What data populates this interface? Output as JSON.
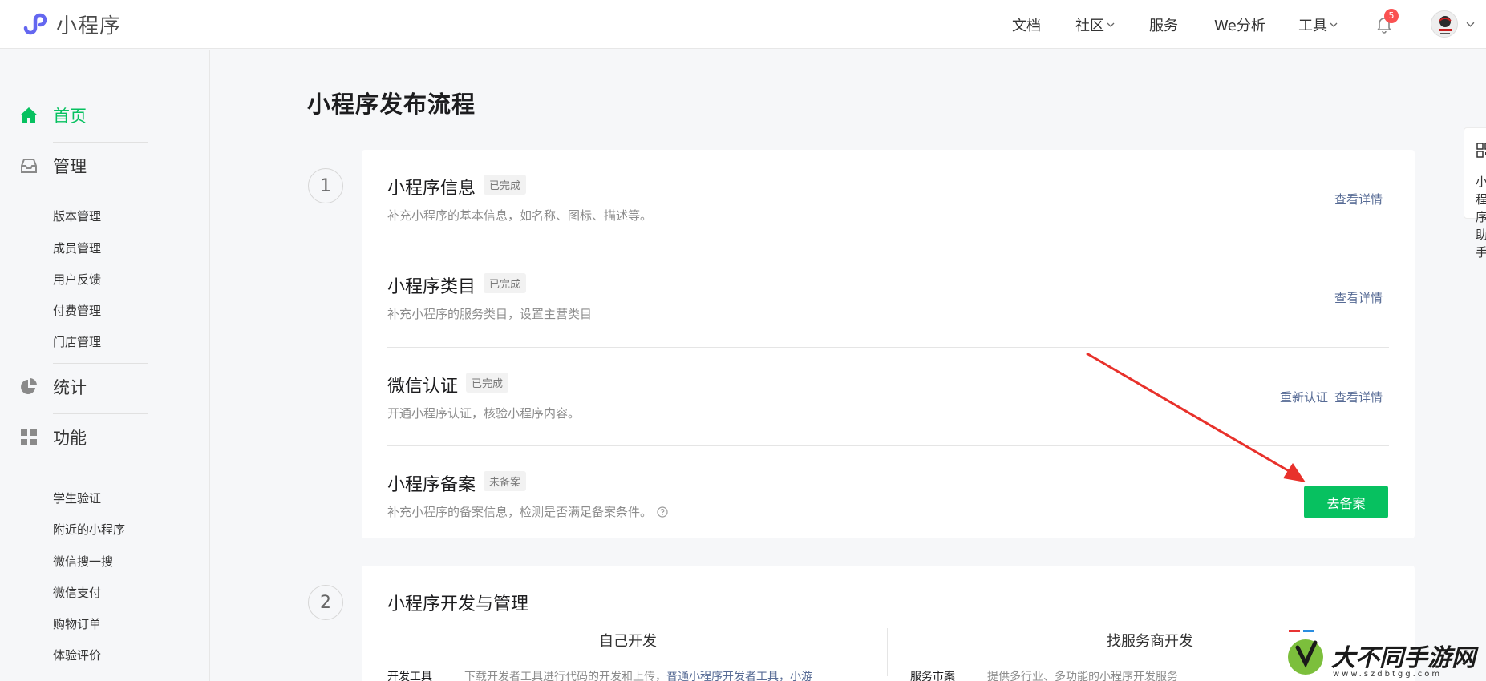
{
  "header": {
    "logo_text": "小程序",
    "nav": [
      {
        "label": "文档",
        "has_dropdown": false
      },
      {
        "label": "社区",
        "has_dropdown": true
      },
      {
        "label": "服务",
        "has_dropdown": false
      },
      {
        "label": "We分析",
        "has_dropdown": false
      },
      {
        "label": "工具",
        "has_dropdown": true
      }
    ],
    "notification_count": "5",
    "icons": [
      "logo-icon",
      "bell-icon",
      "avatar",
      "chevron-down-icon"
    ]
  },
  "sidebar": {
    "home": {
      "label": "首页",
      "icon": "home-icon",
      "active": true
    },
    "manage": {
      "label": "管理",
      "icon": "inbox-icon",
      "items": [
        "版本管理",
        "成员管理",
        "用户反馈",
        "付费管理",
        "门店管理"
      ]
    },
    "stats": {
      "label": "统计",
      "icon": "pie-chart-icon"
    },
    "features": {
      "label": "功能",
      "icon": "grid-icon",
      "items": [
        "学生验证",
        "附近的小程序",
        "微信搜一搜",
        "微信支付",
        "购物订单",
        "体验评价"
      ]
    }
  },
  "main": {
    "page_title": "小程序发布流程",
    "step1": {
      "number": "1",
      "rows": [
        {
          "title": "小程序信息",
          "status": "已完成",
          "desc": "补充小程序的基本信息，如名称、图标、描述等。",
          "links": [
            "查看详情"
          ]
        },
        {
          "title": "小程序类目",
          "status": "已完成",
          "desc": "补充小程序的服务类目，设置主营类目",
          "links": [
            "查看详情"
          ]
        },
        {
          "title": "微信认证",
          "status": "已完成",
          "desc": "开通小程序认证，核验小程序内容。",
          "links": [
            "重新认证",
            "查看详情"
          ]
        },
        {
          "title": "小程序备案",
          "status": "未备案",
          "desc": "补充小程序的备案信息，检测是否满足备案条件。",
          "button": "去备案"
        }
      ]
    },
    "step2": {
      "number": "2",
      "title": "小程序开发与管理",
      "columns": [
        {
          "heading": "自己开发",
          "row_label": "开发工具",
          "row_text": "下载开发者工具进行代码的开发和上传，",
          "row_link": "普通小程序开发者工具",
          "row_tail": "，小游"
        },
        {
          "heading": "找服务商开发",
          "row_label": "服务市案",
          "row_text": "提供多行业、多功能的小程序开发服务"
        }
      ]
    }
  },
  "float_panel": {
    "text": "小程序助手",
    "icon": "qr-code-icon"
  },
  "watermark": {
    "text": "大不同手游网",
    "url": "www.szdbtgg.com"
  },
  "colors": {
    "accent": "#07c160",
    "link": "#576b95",
    "badge": "#fa5151",
    "arrow": "#e8312b"
  }
}
